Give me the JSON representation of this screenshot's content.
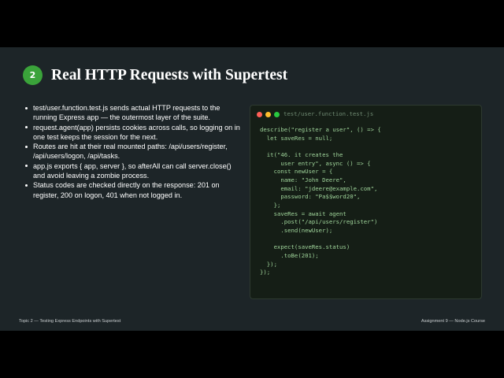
{
  "slide": {
    "number": "2",
    "title": "Real HTTP Requests with Supertest",
    "bullets": [
      "test/user.function.test.js sends actual HTTP requests to the running Express app — the outermost layer of the suite.",
      "request.agent(app) persists cookies across calls, so logging on in one test keeps the session for the next.",
      "Routes are hit at their real mounted paths: /api/users/register, /api/users/logon, /api/tasks.",
      "app.js exports { app, server }, so afterAll can call server.close() and avoid leaving a zombie process.",
      "Status codes are checked directly on the response: 201 on register, 200 on logon, 401 when not logged in."
    ],
    "code": {
      "filename": "test/user.function.test.js",
      "window_dots": [
        "#ff5f57",
        "#febc2e",
        "#28c840"
      ],
      "lines": [
        "describe(\"register a user\", () => {",
        "  let saveRes = null;",
        "",
        "  it(\"46. it creates the",
        "      user entry\", async () => {",
        "    const newUser = {",
        "      name: \"John Deere\",",
        "      email: \"jdeere@example.com\",",
        "      password: \"Pa$$word20\",",
        "    };",
        "    saveRes = await agent",
        "      .post(\"/api/users/register\")",
        "      .send(newUser);",
        "",
        "    expect(saveRes.status)",
        "      .toBe(201);",
        "  });",
        "});"
      ]
    },
    "footer_left": "Topic 2 — Testing Express Endpoints with Supertest",
    "footer_right": "Assignment 9 — Node.js Course"
  },
  "colors": {
    "badge": "#3aa33a",
    "slide_background": "#1d2528",
    "code_background": "#151e16",
    "code_text": "#9fd49a",
    "code_filename": "#6f8a72"
  }
}
